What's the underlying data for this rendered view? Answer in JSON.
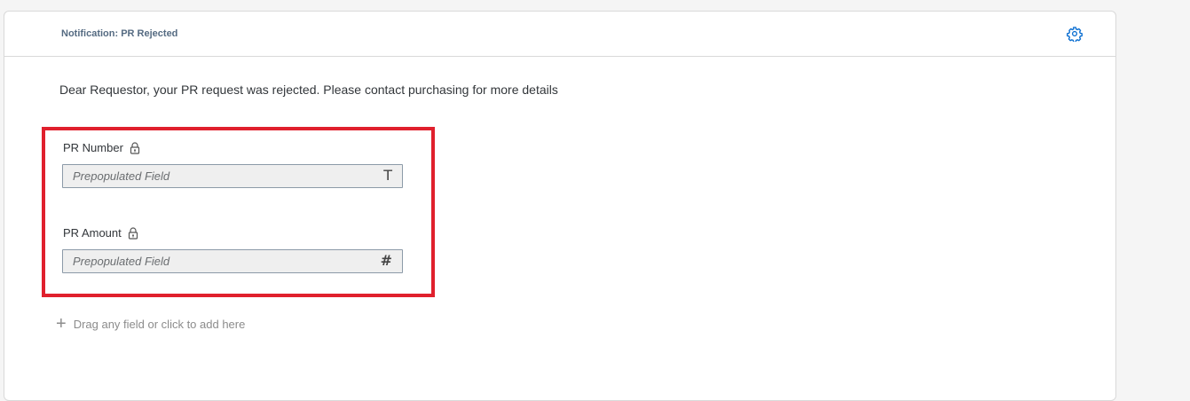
{
  "card": {
    "title": "Notification: PR Rejected"
  },
  "message": "Dear Requestor, your PR request was rejected. Please contact purchasing for more details",
  "fields": [
    {
      "label": "PR Number",
      "placeholder": "Prepopulated Field",
      "type_glyph": "T",
      "locked": true
    },
    {
      "label": "PR Amount",
      "placeholder": "Prepopulated Field",
      "type_glyph": "#",
      "locked": true
    }
  ],
  "add_field": {
    "icon": "plus-icon",
    "label": "Drag any field or click to add here"
  },
  "colors": {
    "highlight": "#e0202d",
    "title": "#556b82",
    "gear": "#0a6ed1"
  }
}
